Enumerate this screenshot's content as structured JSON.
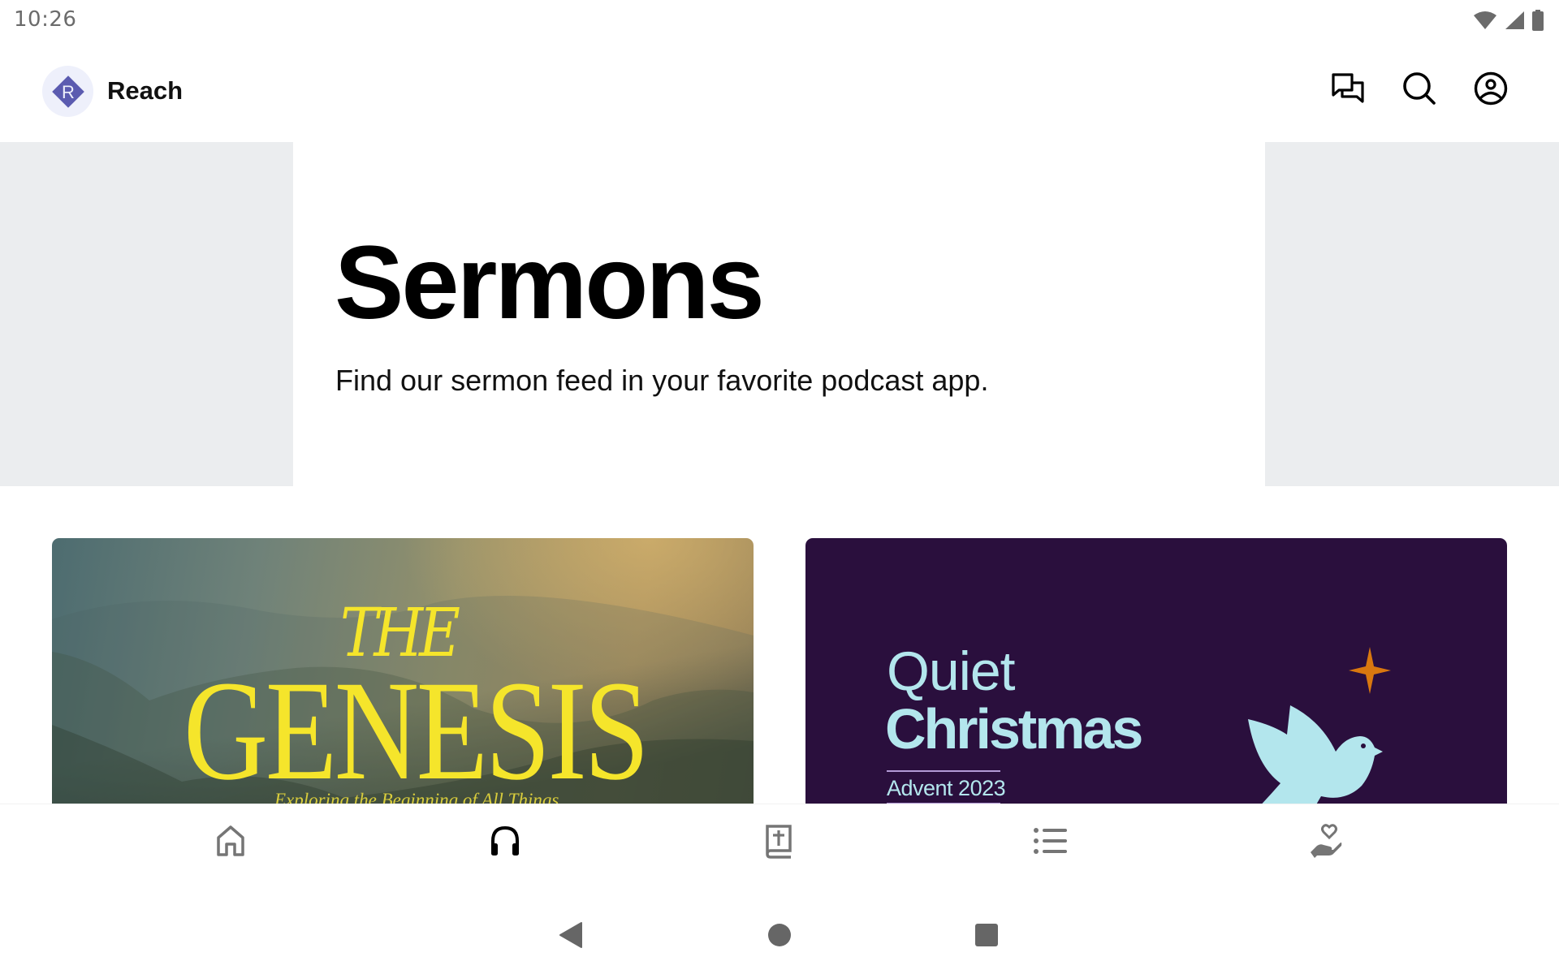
{
  "status_bar": {
    "time": "10:26",
    "icons": [
      "wifi-icon",
      "cellular-signal-icon",
      "battery-icon"
    ]
  },
  "app_bar": {
    "logo_letter": "R",
    "app_name": "Reach",
    "actions": [
      {
        "name": "chat",
        "icon": "chat-bubbles-icon"
      },
      {
        "name": "search",
        "icon": "search-icon"
      },
      {
        "name": "profile",
        "icon": "account-circle-icon"
      }
    ]
  },
  "hero": {
    "title": "Sermons",
    "subtitle": "Find our sermon feed in your favorite podcast app."
  },
  "cards": [
    {
      "series_prefix": "THE",
      "title": "GENESIS",
      "subtitle": "Exploring the Beginning of All Things"
    },
    {
      "title_line1": "Quiet",
      "title_line2": "Christmas",
      "subtitle": "Advent 2023"
    }
  ],
  "bottom_nav": {
    "active_index": 1,
    "items": [
      {
        "name": "home",
        "icon": "home-icon"
      },
      {
        "name": "sermons",
        "icon": "headphones-icon"
      },
      {
        "name": "bible",
        "icon": "bible-icon"
      },
      {
        "name": "list",
        "icon": "list-icon"
      },
      {
        "name": "give",
        "icon": "give-heart-hand-icon"
      }
    ]
  },
  "colors": {
    "logo_bg": "#eef0fb",
    "logo_diamond": "#5b5bb0",
    "hero_band": "#ebedef",
    "genesis_text": "#f5e52b",
    "christmas_bg": "#2a0f3d",
    "christmas_text": "#b3e6ed",
    "star": "#d9780f",
    "nav_active": "#000000",
    "nav_inactive": "#757575"
  }
}
